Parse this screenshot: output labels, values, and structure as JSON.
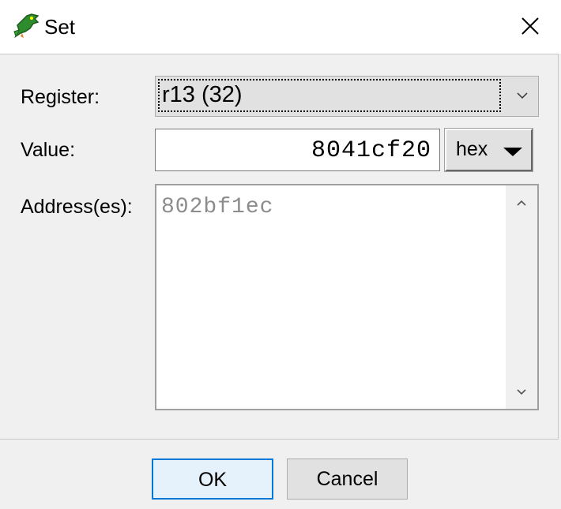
{
  "window": {
    "title": "Set",
    "app_icon": "dragon-icon",
    "close_icon": "close-icon"
  },
  "form": {
    "register_label": "Register:",
    "register_value": "r13 (32)",
    "value_label": "Value:",
    "value": "8041cf20",
    "format": "hex",
    "address_label": "Address(es):",
    "addresses": "802bf1ec"
  },
  "buttons": {
    "ok": "OK",
    "cancel": "Cancel"
  },
  "colors": {
    "accent": "#0078d7",
    "window_bg": "#f0f0f0",
    "placeholder_text": "#8c8c8c"
  }
}
